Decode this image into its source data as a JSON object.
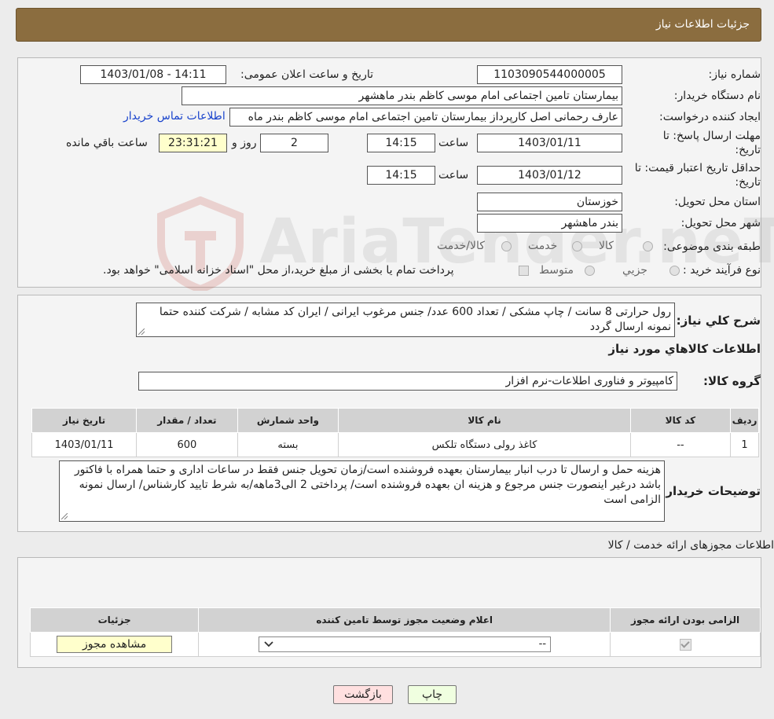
{
  "header": {
    "title": "جزئیات اطلاعات نیاز"
  },
  "watermark": {
    "text": "AriaTender.neT"
  },
  "form": {
    "need_number_label": "شماره نیاز:",
    "need_number": "1103090544000005",
    "announce_label": "تاریخ و ساعت اعلان عمومی:",
    "announce_value": "1403/01/08 - 14:11",
    "buyer_org_label": "نام دستگاه خریدار:",
    "buyer_org": "بیمارستان تامین اجتماعی امام موسی کاظم بندر ماهشهر",
    "creator_label": "ایجاد کننده درخواست:",
    "creator": "عارف رحمانی اصل کارپرداز بیمارستان تامین اجتماعی امام موسی کاظم بندر ماه",
    "contact_link": "اطلاعات تماس خریدار",
    "deadline_label_1": "مهلت ارسال پاسخ: تا",
    "deadline_label_2": "تاریخ:",
    "deadline_date": "1403/01/11",
    "time_label": "ساعت",
    "deadline_time": "14:15",
    "days": "2",
    "days_label": "روز و",
    "remaining": "23:31:21",
    "remaining_label": "ساعت باقي مانده",
    "validity_label_1": "حداقل تاریخ اعتبار قیمت: تا",
    "validity_label_2": "تاریخ:",
    "validity_date": "1403/01/12",
    "validity_time": "14:15",
    "province_label": "استان محل تحویل:",
    "province": "خوزستان",
    "city_label": "شهر محل تحویل:",
    "city": "بندر ماهشهر",
    "category_label": "طبقه بندی موضوعی:",
    "category_options": [
      "کالا",
      "خدمت",
      "کالا/خدمت"
    ],
    "purchase_label": "نوع فرآیند خرید :",
    "purchase_options": [
      "جزيي",
      "متوسط"
    ],
    "purchase_note": "پرداخت تمام یا بخشی از مبلغ خرید،از محل \"اسناد خزانه اسلامی\" خواهد بود."
  },
  "description": {
    "label": "شرح کلي نياز:",
    "text": "رول حرارتی 8 سانت / چاپ مشکی / تعداد 600 عدد/ جنس مرغوب ایرانی / ایران کد مشابه / شرکت کننده حتما نمونه ارسال گردد",
    "goods_info_title": "اطلاعات کالاهاي مورد نياز",
    "goods_group_label": "گروه کالا:",
    "goods_group": "کامپیوتر و فناوری اطلاعات-نرم افزار"
  },
  "goods_table": {
    "headers": [
      "ردیف",
      "کد کالا",
      "نام کالا",
      "واحد شمارش",
      "تعداد / مقدار",
      "تاریخ نیاز"
    ],
    "rows": [
      [
        "1",
        "--",
        "کاغذ رولی دستگاه تلکس",
        "بسته",
        "600",
        "1403/01/11"
      ]
    ]
  },
  "buyer_notes": {
    "label": "توضیحات خریدار:",
    "text": "هزینه حمل و ارسال تا درب انبار بیمارستان بعهده فروشنده است/زمان تحویل جنس فقط در ساعات اداری و حتما همراه با فاکتور باشد درغیر اینصورت جنس مرجوع و هزینه ان بعهده فروشنده است/ پرداختی 2 الی3ماهه/به شرط تایید کارشناس/ ارسال نمونه الزامی است"
  },
  "permits": {
    "title": "اطلاعات مجوزهای ارائه خدمت / کالا",
    "headers": [
      "الزامی بودن ارائه مجوز",
      "اعلام وضعیت مجوز توسط تامین کننده",
      "جزئیات"
    ],
    "select_value": "--",
    "view_button": "مشاهده مجوز"
  },
  "actions": {
    "print": "چاپ",
    "back": "بازگشت"
  }
}
